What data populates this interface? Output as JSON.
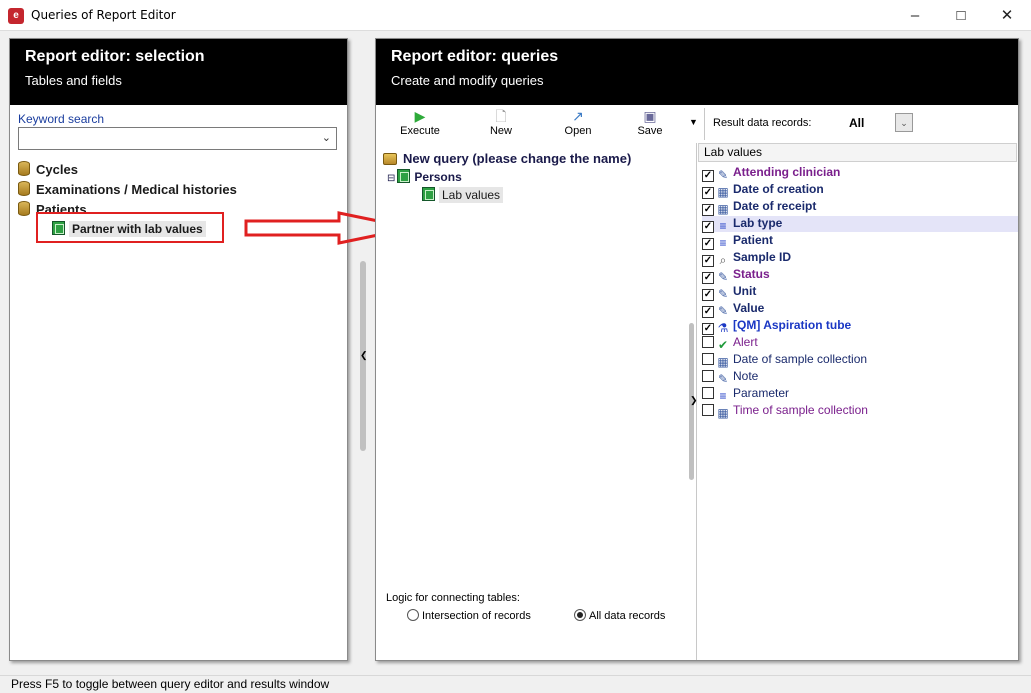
{
  "window": {
    "title": "Queries of Report Editor",
    "icon": "app-logo-icon",
    "controls": [
      "minimize-icon",
      "maximize-icon",
      "close-icon"
    ]
  },
  "left_panel": {
    "title": "Report editor: selection",
    "subtitle": "Tables and fields",
    "keyword_label": "Keyword search",
    "keyword_value": "",
    "tree": {
      "cycles": "Cycles",
      "examinations": "Examinations / Medical histories",
      "patients": "Patients",
      "partner_lab": "Partner with lab values"
    }
  },
  "right_panel": {
    "title": "Report editor: queries",
    "subtitle": "Create and modify queries",
    "toolbar": {
      "execute": "Execute",
      "new": "New",
      "open": "Open",
      "save": "Save"
    },
    "result_label": "Result data records:",
    "result_value": "All",
    "query_tree": {
      "root": "New query (please change the name)",
      "persons": "Persons",
      "lab_values": "Lab values"
    },
    "fields_header": "Lab values",
    "fields": [
      {
        "label": "Attending clinician",
        "checked": true,
        "color": "#7a1f8c",
        "bold": true,
        "icon": "edit-icon"
      },
      {
        "label": "Date of creation",
        "checked": true,
        "color": "#1a2a6c",
        "bold": true,
        "icon": "calendar-icon"
      },
      {
        "label": "Date of receipt",
        "checked": true,
        "color": "#1a2a6c",
        "bold": true,
        "icon": "calendar-icon"
      },
      {
        "label": "Lab type",
        "checked": true,
        "color": "#1a2a6c",
        "bold": true,
        "icon": "list-icon"
      },
      {
        "label": "Patient",
        "checked": true,
        "color": "#1a2a6c",
        "bold": true,
        "icon": "list-icon"
      },
      {
        "label": "Sample ID",
        "checked": true,
        "color": "#1a2a6c",
        "bold": true,
        "icon": "search-icon"
      },
      {
        "label": "Status",
        "checked": true,
        "color": "#7a1f8c",
        "bold": true,
        "icon": "edit-icon"
      },
      {
        "label": "Unit",
        "checked": true,
        "color": "#1a2a6c",
        "bold": true,
        "icon": "edit-icon"
      },
      {
        "label": "Value",
        "checked": true,
        "color": "#1a2a6c",
        "bold": true,
        "icon": "edit-icon"
      },
      {
        "label": "[QM] Aspiration tube",
        "checked": true,
        "color": "#1a37c4",
        "bold": true,
        "icon": "flask-icon"
      },
      {
        "label": "Alert",
        "checked": false,
        "color": "#7a1f8c",
        "bold": false,
        "icon": "check-icon"
      },
      {
        "label": "Date of sample collection",
        "checked": false,
        "color": "#1a2a6c",
        "bold": false,
        "icon": "calendar-icon"
      },
      {
        "label": "Note",
        "checked": false,
        "color": "#1a2a6c",
        "bold": false,
        "icon": "edit-icon"
      },
      {
        "label": "Parameter",
        "checked": false,
        "color": "#1a2a6c",
        "bold": false,
        "icon": "list-icon"
      },
      {
        "label": "Time of sample collection",
        "checked": false,
        "color": "#7a1f8c",
        "bold": false,
        "icon": "calendar-icon"
      }
    ],
    "selected_field": "Lab type",
    "logic_label": "Logic for connecting tables:",
    "logic_options": {
      "intersection": "Intersection of records",
      "all": "All data records"
    },
    "logic_selected": "all"
  },
  "status_bar": "Press F5 to toggle between query editor and results window",
  "colors": {
    "header_bg": "#000000",
    "annotation_red": "#e02020",
    "link_blue": "#1a3d9e"
  }
}
